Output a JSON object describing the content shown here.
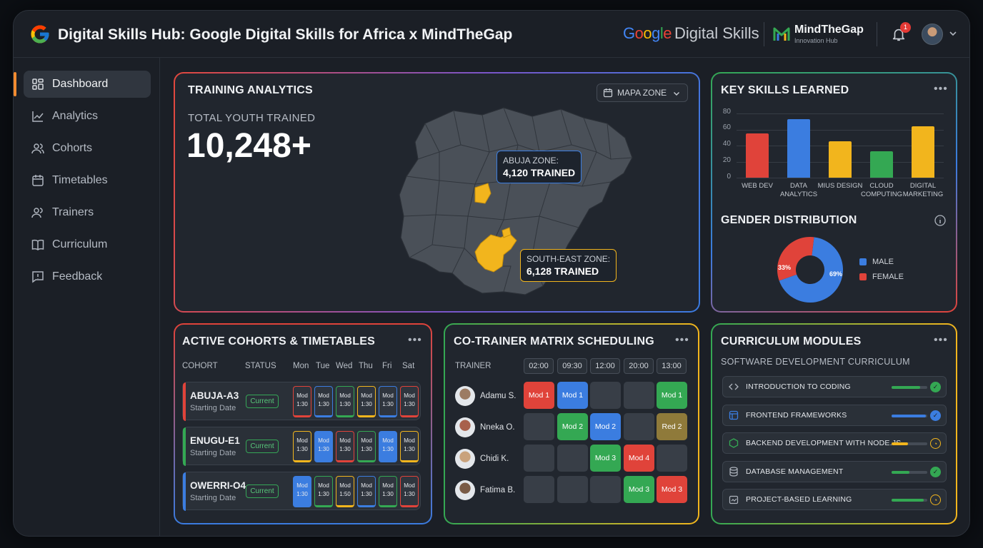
{
  "header": {
    "title": "Digital Skills Hub: Google Digital Skills for Africa x MindTheGap",
    "brand_google_word": "Google",
    "brand_google_suffix": "Digital Skills",
    "brand_mtg_name": "MindTheGap",
    "brand_mtg_sub": "Innovation Hub",
    "notification_count": "1"
  },
  "sidebar": {
    "items": [
      {
        "label": "Dashboard",
        "icon": "dashboard-icon"
      },
      {
        "label": "Analytics",
        "icon": "chart-line-icon"
      },
      {
        "label": "Cohorts",
        "icon": "users-icon"
      },
      {
        "label": "Timetables",
        "icon": "calendar-icon"
      },
      {
        "label": "Trainers",
        "icon": "user-group-icon"
      },
      {
        "label": "Curriculum",
        "icon": "book-icon"
      },
      {
        "label": "Feedback",
        "icon": "message-icon"
      }
    ]
  },
  "training": {
    "title": "TRAINING ANALYTICS",
    "total_label": "TOTAL YOUTH TRAINED",
    "total_value": "10,248+",
    "zone_button": "MAPA ZONE",
    "tooltip_abuja_label": "ABUJA ZONE:",
    "tooltip_abuja_value": "4,120 TRAINED",
    "tooltip_se_label": "SOUTH-EAST ZONE:",
    "tooltip_se_value": "6,128 TRAINED"
  },
  "skills": {
    "title": "KEY SKILLS LEARNED",
    "ticks": [
      "80",
      "60",
      "40",
      "20",
      "0"
    ],
    "gender_title": "GENDER DISTRIBUTION",
    "gender_male_pct": "69%",
    "gender_female_pct": "33%",
    "legend_male": "MALE",
    "legend_female": "FEMALE"
  },
  "chart_data": [
    {
      "type": "bar",
      "title": "KEY SKILLS LEARNED",
      "categories": [
        "WEB DEV",
        "DATA ANALYTICS",
        "MIUS DESIGN",
        "CLOUD COMPUTING",
        "DIGITAL MARKETING"
      ],
      "values": [
        55,
        73,
        45,
        33,
        64
      ],
      "colors": [
        "#e0433a",
        "#3b7de0",
        "#f2b51d",
        "#34a853",
        "#f2b51d"
      ],
      "ylim": [
        0,
        80
      ],
      "grid": true
    },
    {
      "type": "pie",
      "title": "GENDER DISTRIBUTION",
      "categories": [
        "MALE",
        "FEMALE"
      ],
      "values": [
        69,
        33
      ],
      "colors": [
        "#3b7de0",
        "#e0433a"
      ],
      "legend": "right"
    }
  ],
  "cohorts": {
    "title": "ACTIVE COHORTS & TIMETABLES",
    "headers": [
      "COHORT",
      "STATUS",
      "Mon",
      "Tue",
      "Wed",
      "Thu",
      "Fri",
      "Sat"
    ],
    "rows": [
      {
        "name": "ABUJA-A3",
        "sub": "Starting Date",
        "status": "Current",
        "accent": "#e0433a",
        "mods": [
          {
            "t": "Mod",
            "s": "1:30",
            "c": "#e0433a"
          },
          {
            "t": "Mod",
            "s": "1:30",
            "c": "#3b7de0"
          },
          {
            "t": "Mod",
            "s": "1:30",
            "c": "#34a853"
          },
          {
            "t": "Mod",
            "s": "1:30",
            "c": "#f2b51d"
          },
          {
            "t": "Mod",
            "s": "1:30",
            "c": "#3b7de0"
          },
          {
            "t": "Mod",
            "s": "1:30",
            "c": "#e0433a"
          }
        ]
      },
      {
        "name": "ENUGU-E1",
        "sub": "Starting Date",
        "status": "Current",
        "accent": "#34a853",
        "mods": [
          {
            "t": "Mod",
            "s": "1:30",
            "c": "#f2b51d"
          },
          {
            "t": "Mod",
            "s": "1:30",
            "c": "#3b7de0",
            "fill": true
          },
          {
            "t": "Mod",
            "s": "1:30",
            "c": "#e0433a"
          },
          {
            "t": "Mod",
            "s": "1:30",
            "c": "#34a853"
          },
          {
            "t": "Mod",
            "s": "1:30",
            "c": "#3b7de0",
            "fill": true
          },
          {
            "t": "Mod",
            "s": "1:30",
            "c": "#f2b51d"
          }
        ]
      },
      {
        "name": "OWERRI-O4",
        "sub": "Starting Date",
        "status": "Current",
        "accent": "#3b7de0",
        "mods": [
          {
            "t": "Mod",
            "s": "1:30",
            "c": "#3b7de0",
            "fill": true
          },
          {
            "t": "Mod",
            "s": "1:30",
            "c": "#34a853"
          },
          {
            "t": "Mod",
            "s": "1:50",
            "c": "#f2b51d"
          },
          {
            "t": "Mod",
            "s": "1:30",
            "c": "#3b7de0"
          },
          {
            "t": "Mod",
            "s": "1:30",
            "c": "#34a853"
          },
          {
            "t": "Mod",
            "s": "1:30",
            "c": "#e0433a"
          }
        ]
      }
    ]
  },
  "cotrainer": {
    "title": "CO-TRAINER MATRIX SCHEDULING",
    "trainer_header": "TRAINER",
    "times": [
      "02:00",
      "09:30",
      "12:00",
      "20:00",
      "13:00"
    ],
    "rows": [
      {
        "name": "Adamu S.",
        "cells": [
          {
            "t": "Mod 1",
            "c": "#e0433a"
          },
          {
            "t": "Mod 1",
            "c": "#3b7de0"
          },
          {
            "t": "",
            "c": ""
          },
          {
            "t": "",
            "c": ""
          },
          {
            "t": "Mod 1",
            "c": "#34a853"
          }
        ]
      },
      {
        "name": "Nneka O.",
        "cells": [
          {
            "t": "",
            "c": ""
          },
          {
            "t": "Mod 2",
            "c": "#34a853"
          },
          {
            "t": "Mod 2",
            "c": "#3b7de0"
          },
          {
            "t": "",
            "c": ""
          },
          {
            "t": "Red 2",
            "c": "#8f7a3a"
          }
        ]
      },
      {
        "name": "Chidi K.",
        "cells": [
          {
            "t": "",
            "c": ""
          },
          {
            "t": "",
            "c": ""
          },
          {
            "t": "Mod 3",
            "c": "#34a853"
          },
          {
            "t": "Mod 4",
            "c": "#e0433a"
          },
          {
            "t": "",
            "c": ""
          }
        ]
      },
      {
        "name": "Fatima B.",
        "cells": [
          {
            "t": "",
            "c": ""
          },
          {
            "t": "",
            "c": ""
          },
          {
            "t": "",
            "c": ""
          },
          {
            "t": "Mod 3",
            "c": "#34a853"
          },
          {
            "t": "Mod 3",
            "c": "#e0433a"
          }
        ]
      }
    ]
  },
  "curriculum": {
    "title": "CURRICULUM MODULES",
    "subtitle": "SOFTWARE DEVELOPMENT CURRICULUM",
    "modules": [
      {
        "title": "INTRODUCTION TO CODING",
        "progress": 0.8,
        "bar": "#34a853",
        "status": "done",
        "icon": "code-icon"
      },
      {
        "title": "FRONTEND FRAMEWORKS",
        "progress": 0.95,
        "bar": "#3b7de0",
        "status": "done-blue",
        "icon": "layout-icon"
      },
      {
        "title": "BACKEND DEVELOPMENT WITH NODE.JS",
        "progress": 0.45,
        "bar": "#f2b51d",
        "status": "pending",
        "icon": "node-icon"
      },
      {
        "title": "DATABASE MANAGEMENT",
        "progress": 0.5,
        "bar": "#34a853",
        "status": "done",
        "icon": "database-icon"
      },
      {
        "title": "PROJECT-BASED LEARNING",
        "progress": 0.9,
        "bar": "#34a853",
        "status": "pending",
        "icon": "project-icon"
      }
    ]
  }
}
